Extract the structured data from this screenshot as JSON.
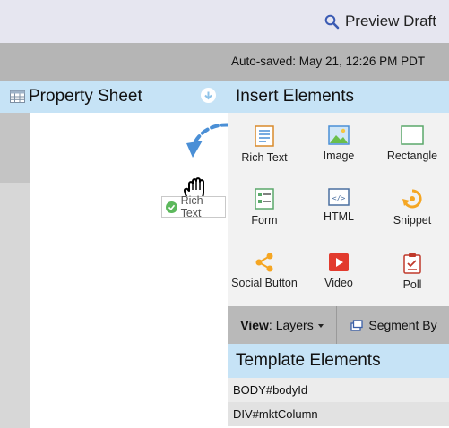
{
  "topbar": {
    "preview_label": "Preview Draft",
    "preview_icon": "magnifier-icon"
  },
  "autosave": {
    "text": "Auto-saved: May 21, 12:26 PM PDT"
  },
  "property_sheet": {
    "title": "Property Sheet",
    "icon": "grid-table-icon"
  },
  "drag": {
    "tag_label": "Rich Text"
  },
  "insert_elements": {
    "title": "Insert Elements",
    "items": [
      {
        "label": "Rich Text",
        "icon": "rich-text-icon"
      },
      {
        "label": "Image",
        "icon": "image-icon"
      },
      {
        "label": "Rectangle",
        "icon": "rectangle-icon"
      },
      {
        "label": "Form",
        "icon": "form-icon"
      },
      {
        "label": "HTML",
        "icon": "html-icon"
      },
      {
        "label": "Snippet",
        "icon": "snippet-icon"
      },
      {
        "label": "Social Button",
        "icon": "social-share-icon"
      },
      {
        "label": "Video",
        "icon": "video-play-icon"
      },
      {
        "label": "Poll",
        "icon": "poll-clipboard-icon"
      }
    ]
  },
  "toolbar": {
    "view_bold": "View",
    "view_value": ": Layers",
    "segment_label": "Segment By"
  },
  "template_elements": {
    "title": "Template Elements",
    "rows": [
      "BODY#bodyId",
      "DIV#mktColumn"
    ]
  },
  "colors": {
    "panel_header": "#c6e3f6",
    "accent_blue": "#4a8fd6",
    "snippet_orange": "#f5a623",
    "video_red": "#e23b2e",
    "check_green": "#5cb85c"
  }
}
